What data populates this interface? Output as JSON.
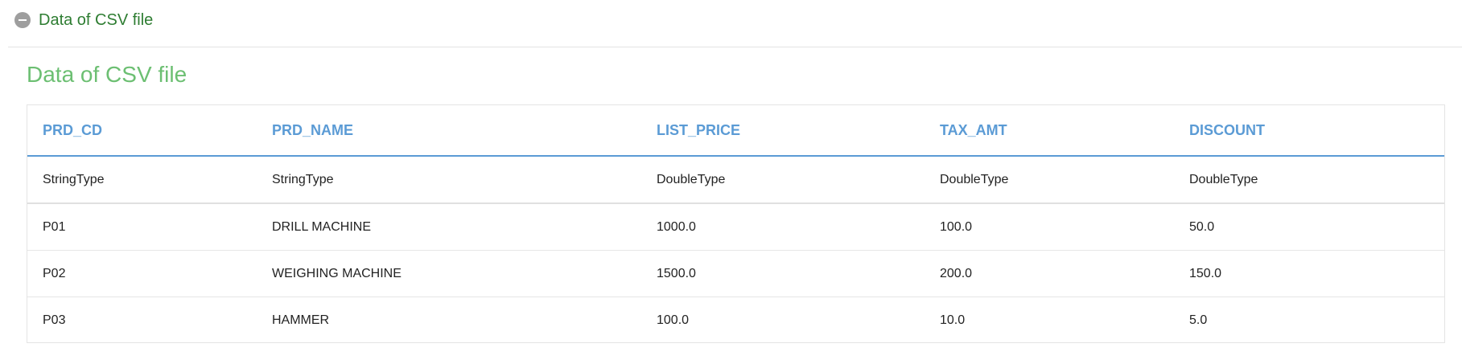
{
  "collapse_header": {
    "title": "Data of CSV file",
    "toggle_icon": "minus-circle-icon"
  },
  "section": {
    "title": "Data of CSV file"
  },
  "table": {
    "headers": [
      "PRD_CD",
      "PRD_NAME",
      "LIST_PRICE",
      "TAX_AMT",
      "DISCOUNT"
    ],
    "types": [
      "StringType",
      "StringType",
      "DoubleType",
      "DoubleType",
      "DoubleType"
    ],
    "rows": [
      [
        "P01",
        "DRILL MACHINE",
        "1000.0",
        "100.0",
        "50.0"
      ],
      [
        "P02",
        "WEIGHING MACHINE",
        "1500.0",
        "200.0",
        "150.0"
      ],
      [
        "P03",
        "HAMMER",
        "100.0",
        "10.0",
        "5.0"
      ]
    ]
  },
  "colors": {
    "header_title": "#2e7d32",
    "section_title": "#6cbf72",
    "column_header": "#5b9bd5",
    "icon": "#9e9e9e"
  }
}
